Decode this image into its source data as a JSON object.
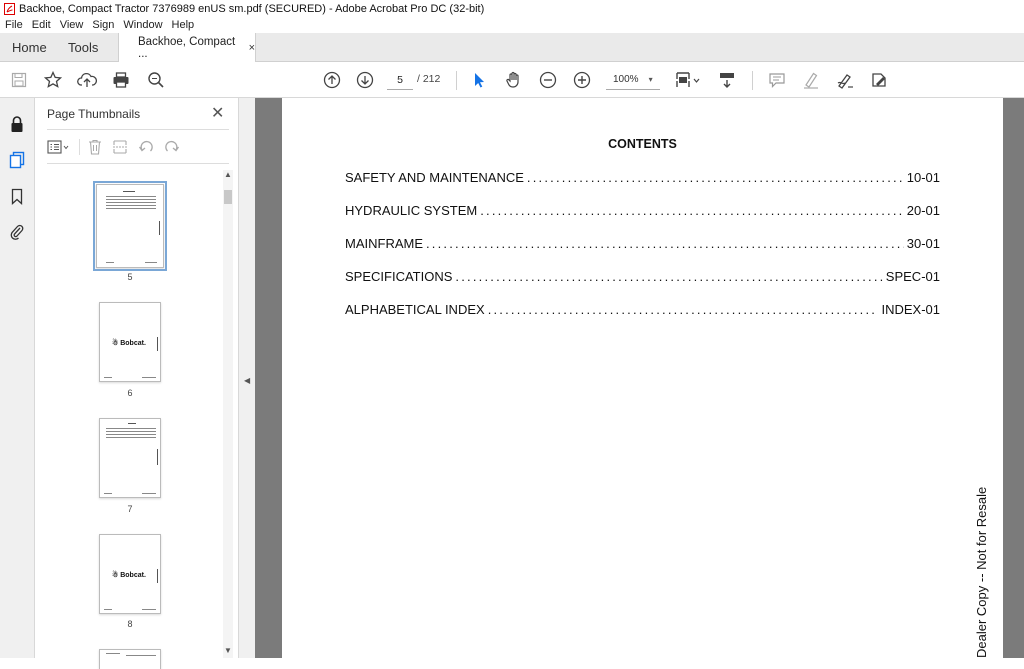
{
  "window": {
    "title": "Backhoe, Compact Tractor 7376989 enUS sm.pdf (SECURED) - Adobe Acrobat Pro DC (32-bit)"
  },
  "menu": [
    "File",
    "Edit",
    "View",
    "Sign",
    "Window",
    "Help"
  ],
  "tabs": {
    "home": "Home",
    "tools": "Tools",
    "document": "Backhoe, Compact ...",
    "close_glyph": "×"
  },
  "toolbar": {
    "current_page": "5",
    "total_pages": "/ 212",
    "zoom": "100%",
    "zoom_caret": "▾",
    "icons": [
      "save-icon",
      "bookmark-star-icon",
      "upload-icon",
      "print-icon",
      "search-icon",
      "prev-page-icon",
      "next-page-icon",
      "select-cursor-icon",
      "hand-icon",
      "zoom-out-icon",
      "zoom-in-icon",
      "page-view-icon",
      "scroll-mode-icon",
      "comment-icon",
      "highlight-icon",
      "sign-icon",
      "fill-sign-icon"
    ],
    "accent": "#1473e6"
  },
  "thumbnails_panel": {
    "title": "Page Thumbnails",
    "close_glyph": "✕",
    "pages": [
      {
        "label": "5",
        "selected": true,
        "kind": "toc"
      },
      {
        "label": "6",
        "selected": false,
        "kind": "logo"
      },
      {
        "label": "7",
        "selected": false,
        "kind": "toc"
      },
      {
        "label": "8",
        "selected": false,
        "kind": "logo"
      }
    ],
    "logo_text": "☃ Bobcat."
  },
  "document": {
    "heading": "CONTENTS",
    "toc": [
      {
        "title": "SAFETY AND MAINTENANCE",
        "page": "10-01"
      },
      {
        "title": "HYDRAULIC SYSTEM",
        "page": "20-01"
      },
      {
        "title": "MAINFRAME",
        "page": "30-01"
      },
      {
        "title": "SPECIFICATIONS",
        "page": "SPEC-01"
      },
      {
        "title": "ALPHABETICAL INDEX",
        "page": "INDEX-01"
      }
    ],
    "watermark": "Dealer Copy -- Not for Resale"
  }
}
